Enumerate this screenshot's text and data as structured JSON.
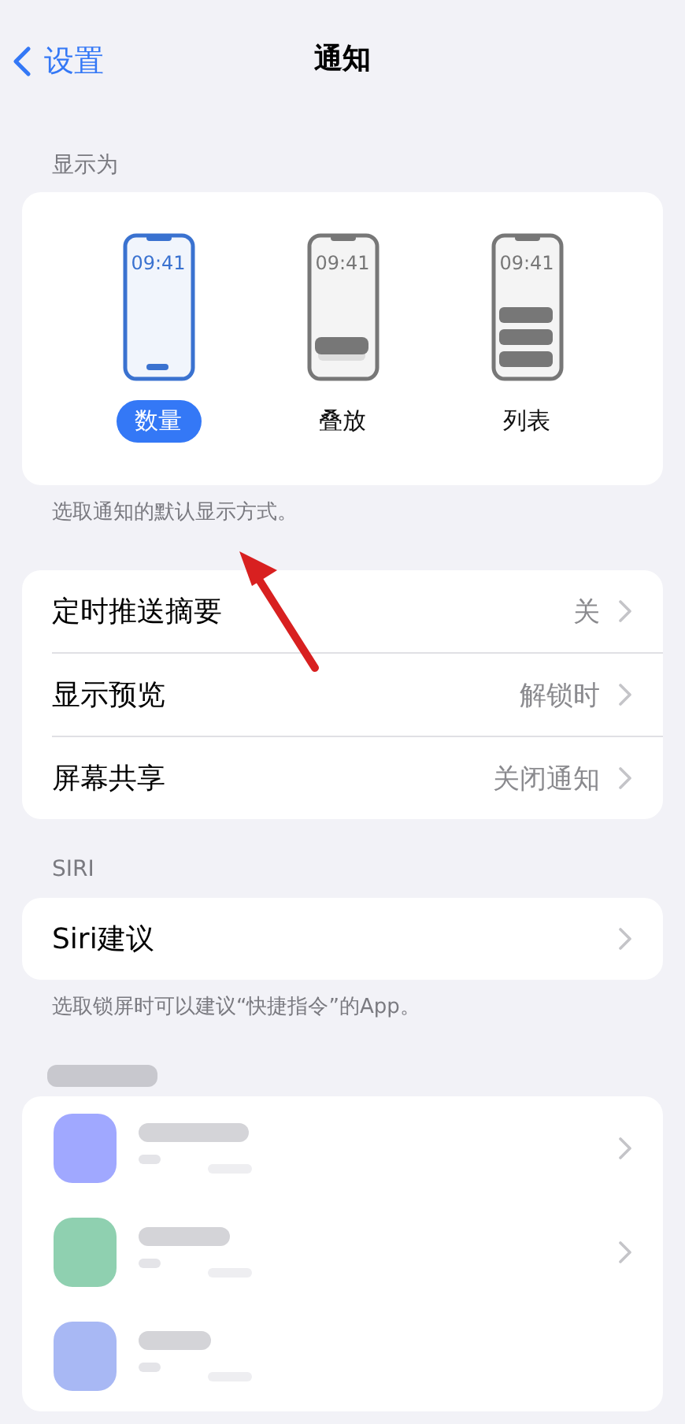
{
  "nav": {
    "back": "设置",
    "title": "通知"
  },
  "display": {
    "header": "显示为",
    "options": [
      {
        "kind": "count",
        "time": "09:41",
        "label": "数量",
        "selected": true
      },
      {
        "kind": "stack",
        "time": "09:41",
        "label": "叠放",
        "selected": false
      },
      {
        "kind": "list",
        "time": "09:41",
        "label": "列表",
        "selected": false
      }
    ],
    "footer": "选取通知的默认显示方式。"
  },
  "settings": [
    {
      "label": "定时推送摘要",
      "value": "关"
    },
    {
      "label": "显示预览",
      "value": "解锁时"
    },
    {
      "label": "屏幕共享",
      "value": "关闭通知"
    }
  ],
  "siri": {
    "header": "SIRI",
    "rows": [
      {
        "label": "Siri建议"
      }
    ],
    "footer": "选取锁屏时可以建议“快捷指令”的App。"
  },
  "app_rows": [
    {
      "kind": "picture",
      "color": "#a0a8ff",
      "chevron": true
    },
    {
      "kind": "picture",
      "color": "#8fd0b0",
      "chevron": true
    },
    {
      "kind": "picture",
      "color": "#a8b8f4",
      "chevron": false
    }
  ]
}
